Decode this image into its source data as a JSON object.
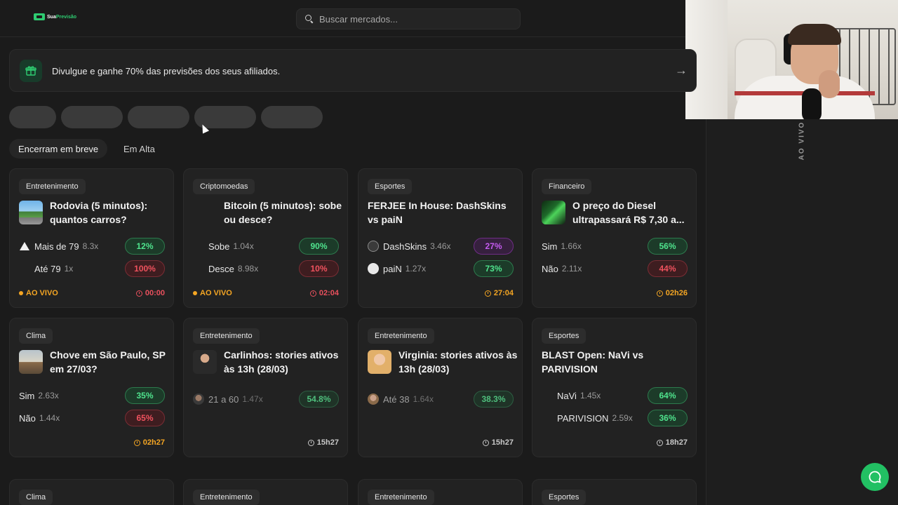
{
  "header": {
    "logo_text_1": "Sua",
    "logo_text_2": "Previsão",
    "search_placeholder": "Buscar mercados..."
  },
  "banner": {
    "text": "Divulgue e ganhe 70% das previsões dos seus afiliados.",
    "arrow": "→"
  },
  "tabs": [
    {
      "label": "Encerram em breve",
      "active": true
    },
    {
      "label": "Em Alta",
      "active": false
    }
  ],
  "side_panel": {
    "live_label": "AO VIVO"
  },
  "cards": [
    {
      "category": "Entretenimento",
      "title": "Rodovia (5 minutos): quantos carros?",
      "outcomes": [
        {
          "label": "Mais de 79",
          "mult": "8.3x",
          "pct": "12%"
        },
        {
          "label": "Até 79",
          "mult": "1x",
          "pct": "100%"
        }
      ],
      "live": "AO VIVO",
      "time": "00:00"
    },
    {
      "category": "Criptomoedas",
      "title": "Bitcoin (5 minutos): sobe ou desce?",
      "outcomes": [
        {
          "label": "Sobe",
          "mult": "1.04x",
          "pct": "90%"
        },
        {
          "label": "Desce",
          "mult": "8.98x",
          "pct": "10%"
        }
      ],
      "live": "AO VIVO",
      "time": "02:04"
    },
    {
      "category": "Esportes",
      "title": "FERJEE In House: DashSkins vs paiN",
      "outcomes": [
        {
          "label": "DashSkins",
          "mult": "3.46x",
          "pct": "27%"
        },
        {
          "label": "paiN",
          "mult": "1.27x",
          "pct": "73%"
        }
      ],
      "time": "27:04"
    },
    {
      "category": "Financeiro",
      "title": "O preço do Diesel ultrapassará R$ 7,30 a...",
      "outcomes": [
        {
          "label": "Sim",
          "mult": "1.66x",
          "pct": "56%"
        },
        {
          "label": "Não",
          "mult": "2.11x",
          "pct": "44%"
        }
      ],
      "time": "02h26"
    },
    {
      "category": "Clima",
      "title": "Chove em São Paulo, SP em 27/03?",
      "outcomes": [
        {
          "label": "Sim",
          "mult": "2.63x",
          "pct": "35%"
        },
        {
          "label": "Não",
          "mult": "1.44x",
          "pct": "65%"
        }
      ],
      "time": "02h27"
    },
    {
      "category": "Entretenimento",
      "title": "Carlinhos: stories ativos às 13h (28/03)",
      "outcomes": [
        {
          "label": "21 a 60",
          "mult": "1.47x",
          "pct": "54.8%"
        }
      ],
      "time": "15h27"
    },
    {
      "category": "Entretenimento",
      "title": "Virginia: stories ativos às 13h (28/03)",
      "outcomes": [
        {
          "label": "Até 38",
          "mult": "1.64x",
          "pct": "38.3%"
        }
      ],
      "time": "15h27"
    },
    {
      "category": "Esportes",
      "title": "BLAST Open: NaVi vs PARIVISION",
      "outcomes": [
        {
          "label": "NaVi",
          "mult": "1.45x",
          "pct": "64%"
        },
        {
          "label": "PARIVISION",
          "mult": "2.59x",
          "pct": "36%"
        }
      ],
      "time": "18h27"
    }
  ],
  "bottom_row_categories": [
    "Clima",
    "Entretenimento",
    "Entretenimento",
    "Esportes"
  ],
  "colors": {
    "background": "#1b1b1b",
    "card": "#222222",
    "green": "#4fe38d",
    "red": "#f0525e",
    "purple": "#c55bf0",
    "orange": "#f5a623",
    "chat_button": "#22c063"
  }
}
